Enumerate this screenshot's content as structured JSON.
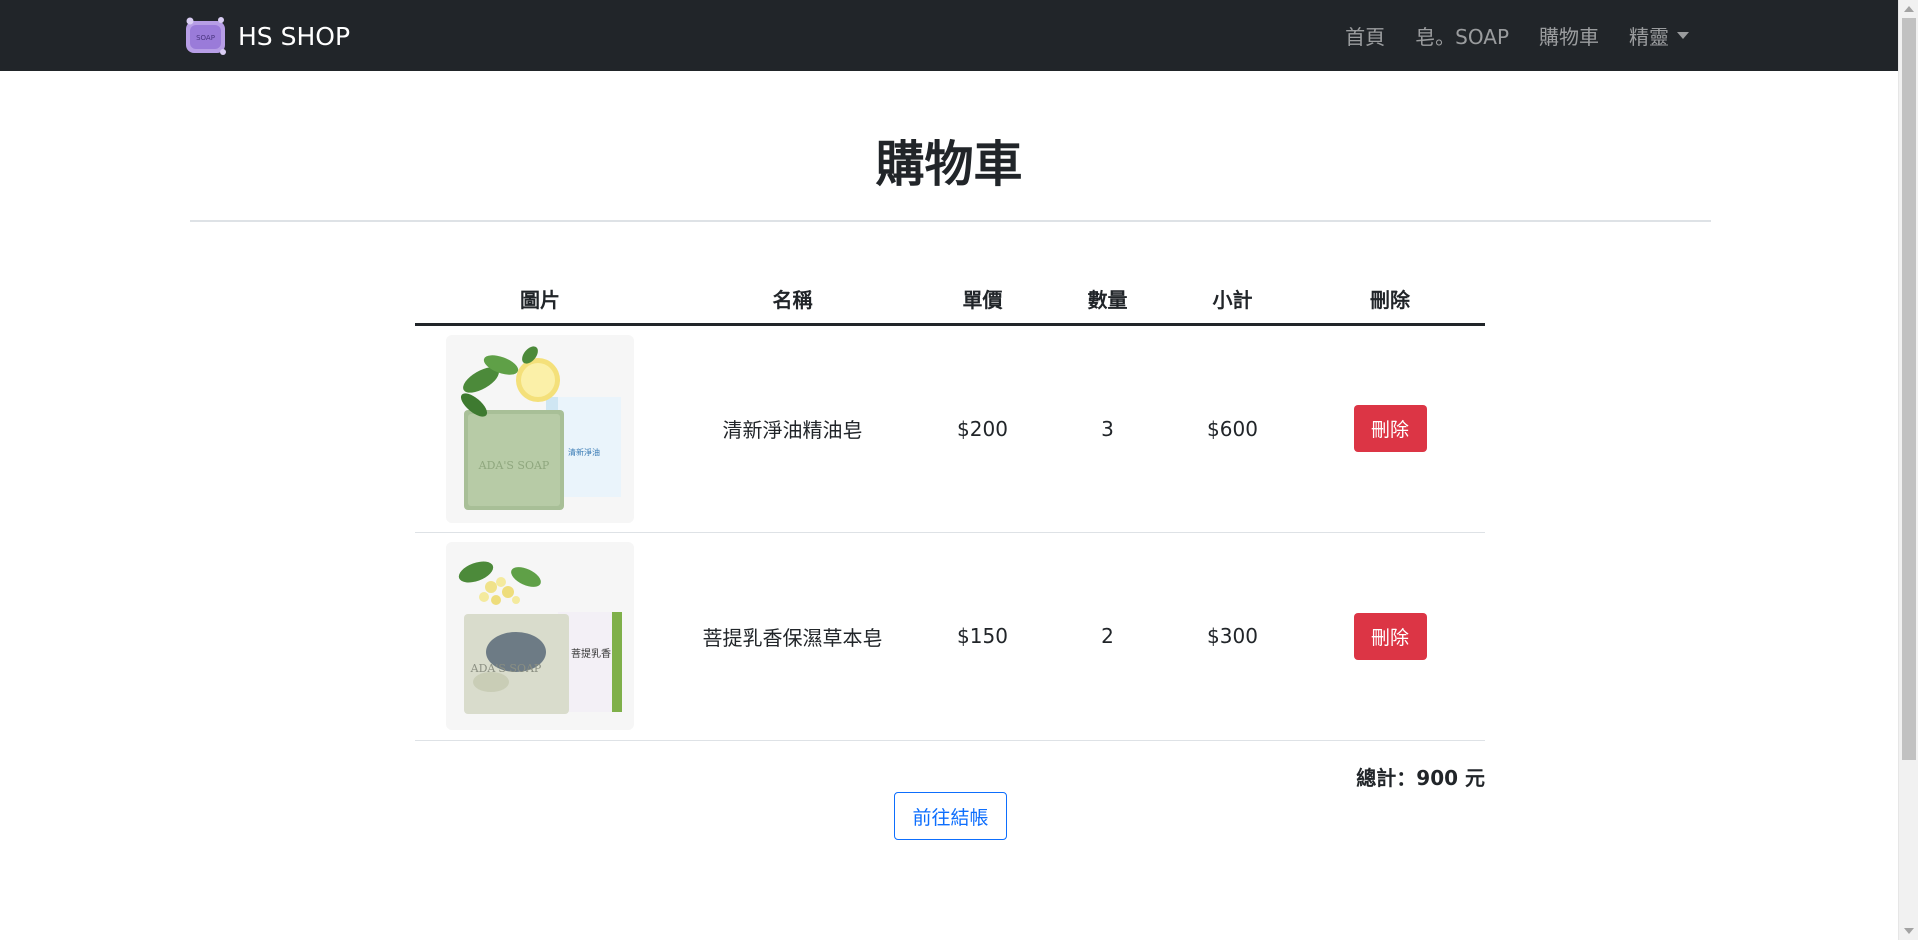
{
  "navbar": {
    "brand_logo_text": "SOAP",
    "brand": "HS SHOP",
    "links": [
      "首頁",
      "皂。SOAP",
      "購物車"
    ],
    "dropdown_label": "精靈"
  },
  "page": {
    "title": "購物車"
  },
  "table": {
    "headers": [
      "圖片",
      "名稱",
      "單價",
      "數量",
      "小計",
      "刪除"
    ],
    "rows": [
      {
        "name": "清新淨油精油皂",
        "price": "$200",
        "qty": "3",
        "subtotal": "$600",
        "delete_label": "刪除",
        "image_label": "ADA'S SOAP",
        "box_label": "清新淨油"
      },
      {
        "name": "菩提乳香保濕草本皂",
        "price": "$150",
        "qty": "2",
        "subtotal": "$300",
        "delete_label": "刪除",
        "image_label": "ADA'S SOAP",
        "box_label": "菩提乳香"
      }
    ]
  },
  "summary": {
    "total": "總計：900 元",
    "checkout_label": "前往結帳"
  },
  "colors": {
    "navbar_bg": "#212529",
    "danger": "#dc3545",
    "primary": "#0d6efd"
  }
}
